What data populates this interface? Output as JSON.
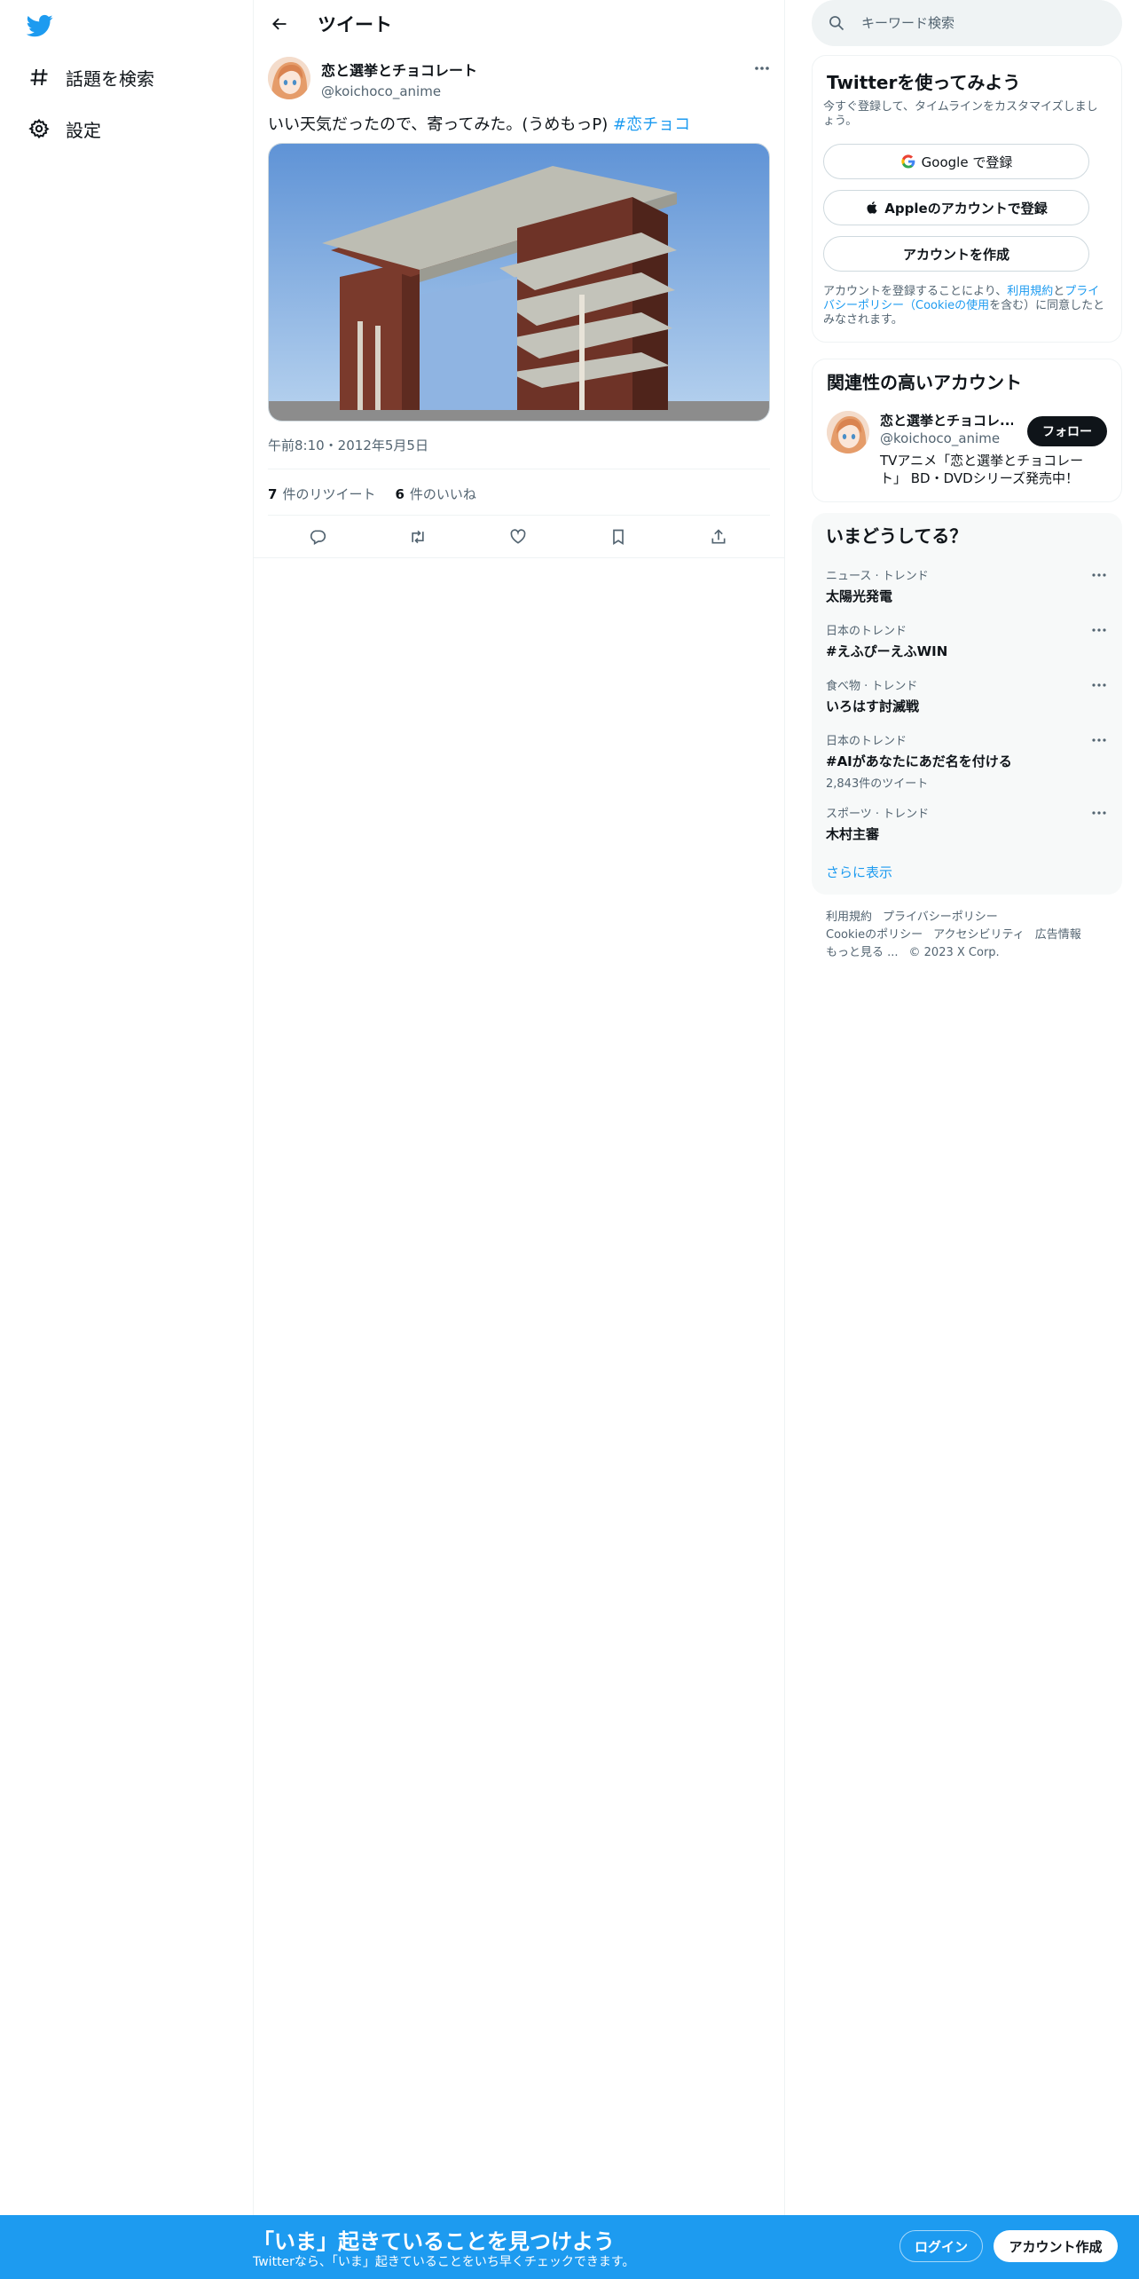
{
  "nav": {
    "items": [
      {
        "label": "話題を検索",
        "icon": "hashtag-icon"
      },
      {
        "label": "設定",
        "icon": "gear-icon"
      }
    ]
  },
  "header": {
    "title": "ツイート"
  },
  "tweet": {
    "author_name": "恋と選挙とチョコレート",
    "author_handle": "@koichoco_anime",
    "text": "いい天気だったので、寄ってみた。(うめもっP)",
    "hashtag": "#恋チョコ",
    "timestamp": "午前8:10・2012年5月5日",
    "retweets_count": "7",
    "retweets_label": "件のリツイート",
    "likes_count": "6",
    "likes_label": "件のいいね"
  },
  "search": {
    "placeholder": "キーワード検索"
  },
  "signup_card": {
    "title": "Twitterを使ってみよう",
    "subtitle": "今すぐ登録して、タイムラインをカスタマイズしましょう。",
    "google_label": "Google で登録",
    "apple_label": "Appleのアカウントで登録",
    "create_label": "アカウントを作成",
    "legal_prefix": "アカウントを登録することにより、",
    "terms_link": "利用規約",
    "and": "と",
    "privacy_link": "プライバシーポリシー",
    "cookie_open": "（",
    "cookie_link": "Cookieの使用",
    "legal_suffix": "を含む）に同意したとみなされます。"
  },
  "related": {
    "title": "関連性の高いアカウント",
    "name": "恋と選挙とチョコレ...",
    "handle": "@koichoco_anime",
    "follow_label": "フォロー",
    "bio": "TVアニメ「恋と選挙とチョコレート」 BD・DVDシリーズ発売中！"
  },
  "trends": {
    "title": "いまどうしてる？",
    "items": [
      {
        "context": "ニュース · トレンド",
        "name": "太陽光発電",
        "count": ""
      },
      {
        "context": "日本のトレンド",
        "name": "#えふぴーえふWIN",
        "count": ""
      },
      {
        "context": "食べ物 · トレンド",
        "name": "いろはす討滅戦",
        "count": ""
      },
      {
        "context": "日本のトレンド",
        "name": "#AIがあなたにあだ名を付ける",
        "count": "2,843件のツイート"
      },
      {
        "context": "スポーツ · トレンド",
        "name": "木村主審",
        "count": ""
      }
    ],
    "show_more": "さらに表示"
  },
  "footer": {
    "terms": "利用規約",
    "privacy": "プライバシーポリシー",
    "cookie": "Cookieのポリシー",
    "accessibility": "アクセシビリティ",
    "ads": "広告情報",
    "more": "もっと見る ...",
    "copyright": "© 2023 X Corp."
  },
  "banner": {
    "title": "「いま」起きていることを見つけよう",
    "subtitle": "Twitterなら、「いま」起きていることをいち早くチェックできます。",
    "login_label": "ログイン",
    "signup_label": "アカウント作成"
  },
  "colors": {
    "accent": "#1d9bf0",
    "text": "#0f1419",
    "secondary": "#536471"
  }
}
